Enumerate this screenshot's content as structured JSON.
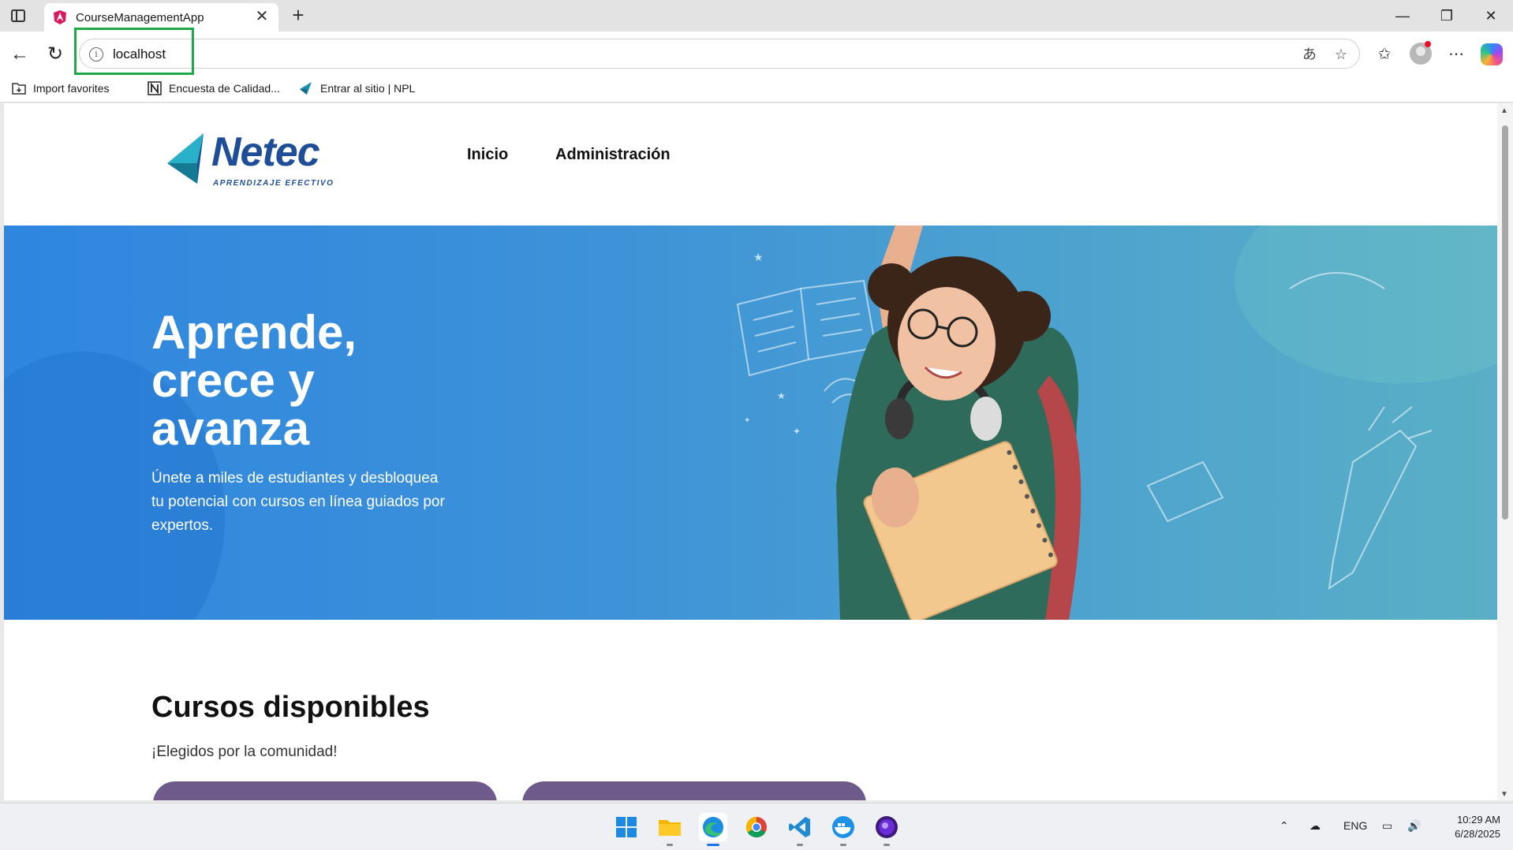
{
  "browser": {
    "tab_title": "CourseManagementApp",
    "address": "localhost",
    "bookmarks": [
      {
        "label": "Import favorites",
        "icon": "import-folder-icon"
      },
      {
        "label": "Encuesta de Calidad...",
        "icon": "notion-icon"
      },
      {
        "label": "Entrar al sitio | NPL",
        "icon": "netec-arrow-icon"
      }
    ]
  },
  "site": {
    "logo_word": "Netec",
    "logo_tagline": "APRENDIZAJE EFECTIVO",
    "nav": [
      "Inicio",
      "Administración"
    ],
    "hero_title": "Aprende, crece y avanza",
    "hero_subtitle": "Únete a miles de estudiantes y desbloquea tu potencial con cursos en línea guiados por expertos.",
    "section_title": "Cursos disponibles",
    "section_subtitle": "¡Elegidos por la comunidad!"
  },
  "taskbar": {
    "apps": [
      "start-icon",
      "file-explorer-icon",
      "edge-icon",
      "chrome-icon",
      "vscode-icon",
      "docker-icon",
      "obs-icon"
    ],
    "language": "ENG",
    "time": "10:29 AM",
    "date": "6/28/2025"
  },
  "colors": {
    "hero_start": "#2f86df",
    "hero_end": "#5aafc6",
    "brand": "#1f4e98",
    "highlight": "#21a84a",
    "card": "#6e5b8c"
  }
}
